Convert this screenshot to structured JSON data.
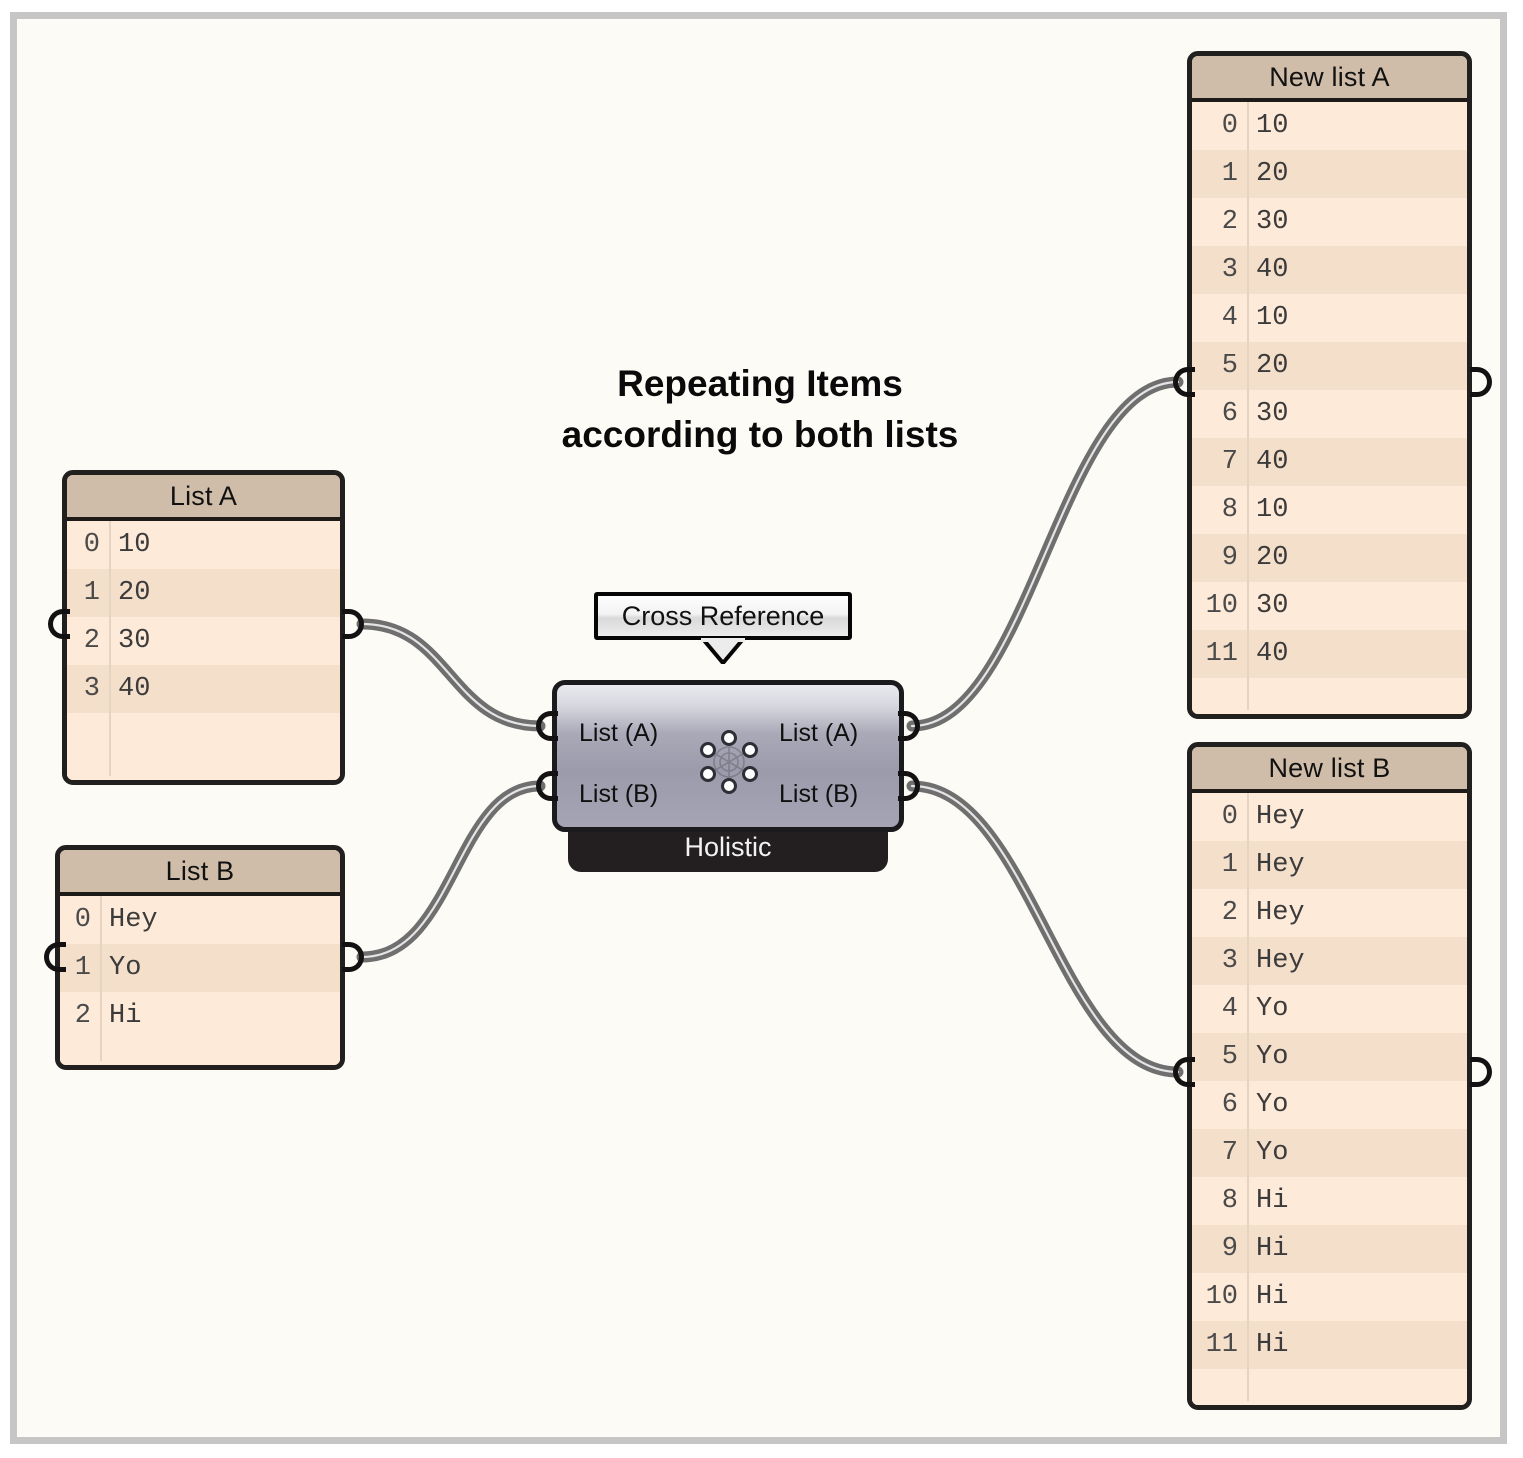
{
  "canvas": {
    "background_color": "#fdfbf5",
    "border_color": "#c6c6c6"
  },
  "title": {
    "line1": "Repeating Items",
    "line2": "according to both lists"
  },
  "tooltip": {
    "label": "Cross Reference"
  },
  "node": {
    "footer_label": "Holistic",
    "icon": "cross-reference-hex-icon",
    "inputs": [
      {
        "label": "List (A)"
      },
      {
        "label": "List (B)"
      }
    ],
    "outputs": [
      {
        "label": "List (A)"
      },
      {
        "label": "List (B)"
      }
    ],
    "colors": {
      "body_top": "#e9eaef",
      "body_bottom": "#a4a4b4",
      "footer": "#231f20",
      "border": "#1b1a1c"
    }
  },
  "panels": [
    {
      "id": "list-a",
      "title": "List A",
      "indices": [
        "0",
        "1",
        "2",
        "3"
      ],
      "values": [
        "10",
        "20",
        "30",
        "40"
      ],
      "trailing_blank_rows": 2
    },
    {
      "id": "list-b",
      "title": "List B",
      "indices": [
        "0",
        "1",
        "2"
      ],
      "values": [
        "Hey",
        "Yo",
        "Hi"
      ],
      "trailing_blank_rows": 1
    },
    {
      "id": "new-list-a",
      "title": "New list A",
      "indices": [
        "0",
        "1",
        "2",
        "3",
        "4",
        "5",
        "6",
        "7",
        "8",
        "9",
        "10",
        "11"
      ],
      "values": [
        "10",
        "20",
        "30",
        "40",
        "10",
        "20",
        "30",
        "40",
        "10",
        "20",
        "30",
        "40"
      ],
      "trailing_blank_rows": 1
    },
    {
      "id": "new-list-b",
      "title": "New list B",
      "indices": [
        "0",
        "1",
        "2",
        "3",
        "4",
        "5",
        "6",
        "7",
        "8",
        "9",
        "10",
        "11"
      ],
      "values": [
        "Hey",
        "Hey",
        "Hey",
        "Hey",
        "Yo",
        "Yo",
        "Yo",
        "Yo",
        "Hi",
        "Hi",
        "Hi",
        "Hi"
      ],
      "trailing_blank_rows": 1
    }
  ],
  "palette": {
    "panel_header": "#cfbda9",
    "panel_row_light": "#fdead8",
    "panel_row_dark": "#f4dfca",
    "panel_border": "#221f1f",
    "wire": "#6f6f6f",
    "wire_highlight": "#d9d9d9"
  }
}
